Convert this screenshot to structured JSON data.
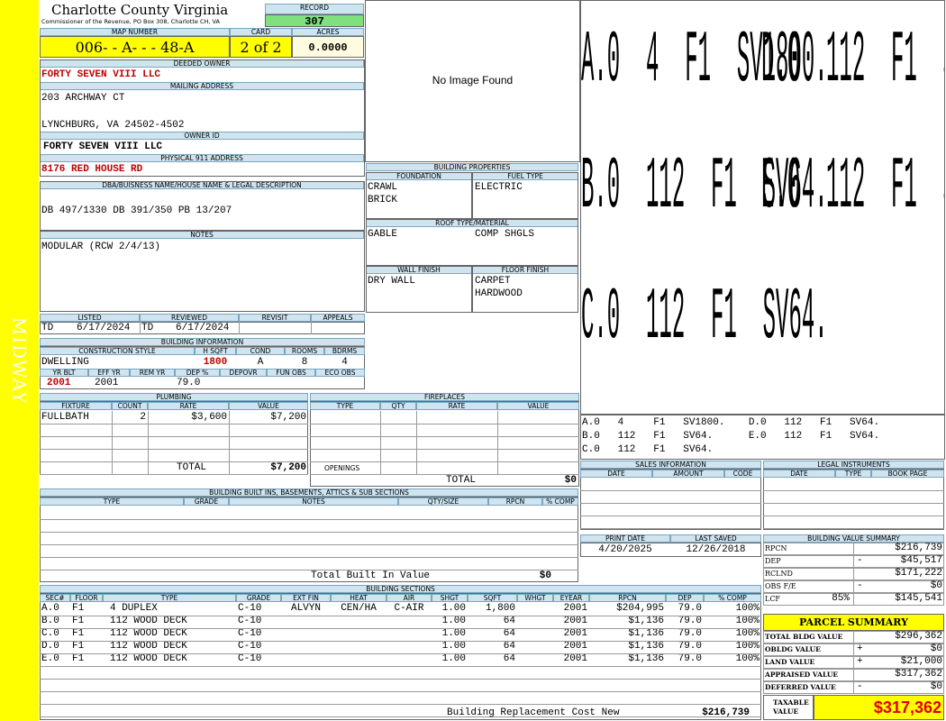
{
  "side_label": "MIDWAY",
  "header": {
    "county": "Charlotte County Virginia",
    "address": "Commissioner of the Revenue, PO Box 308, Charlotte CH, VA",
    "record_label": "RECORD",
    "record_value": "307",
    "map_number_label": "MAP NUMBER",
    "map_number": "006- - A- - - 48-A",
    "card_label": "CARD",
    "card_value": "2 of 2",
    "acres_label": "ACRES",
    "acres_value": "0.0000"
  },
  "owner": {
    "deeded_owner_label": "DEEDED OWNER",
    "deeded_owner": "FORTY SEVEN VIII LLC",
    "mailing_address_label": "MAILING ADDRESS",
    "mailing_line1": "203 ARCHWAY CT",
    "mailing_line2": "LYNCHBURG, VA 24502-4502",
    "owner_id_label": "OWNER ID",
    "owner_id": "FORTY SEVEN VIII LLC",
    "physical_address_label": "PHYSICAL 911 ADDRESS",
    "physical_address": "8176 RED HOUSE RD",
    "dba_label": "DBA/BUISNESS NAME/HOUSE NAME & LEGAL DESCRIPTION",
    "dba_value": "DB 497/1330 DB 391/350 PB 13/207",
    "notes_label": "NOTES",
    "notes_value": "MODULAR (RCW 2/4/13)"
  },
  "image": {
    "placeholder": "No Image Found"
  },
  "building_properties": {
    "title": "BUILDING PROPERTIES",
    "foundation_label": "FOUNDATION",
    "foundation_1": "CRAWL",
    "foundation_2": "BRICK",
    "fuel_label": "FUEL TYPE",
    "fuel_1": "ELECTRIC",
    "roof_label": "ROOF TYPE/MATERIAL",
    "roof_type": "GABLE",
    "roof_material": "COMP SHGLS",
    "wall_label": "WALL FINISH",
    "wall_1": "DRY WALL",
    "floor_label": "FLOOR FINISH",
    "floor_1": "CARPET",
    "floor_2": "HARDWOOD"
  },
  "review": {
    "listed_label": "LISTED",
    "listed_by": "TD",
    "listed_date": "6/17/2024",
    "reviewed_label": "REVIEWED",
    "reviewed_by": "TD",
    "reviewed_date": "6/17/2024",
    "revisit_label": "REVISIT",
    "appeals_label": "APPEALS"
  },
  "building_info": {
    "title": "BUILDING INFORMATION",
    "construction_style_label": "CONSTRUCTION STYLE",
    "construction_style": "DWELLING",
    "hsqft_label": "H SQFT",
    "hsqft": "1800",
    "cond_label": "COND",
    "cond": "A",
    "rooms_label": "ROOMS",
    "rooms": "8",
    "bdrms_label": "BDRMS",
    "bdrms": "4",
    "yr_blt_label": "YR BLT",
    "yr_blt": "2001",
    "eff_yr_label": "EFF YR",
    "eff_yr": "2001",
    "rem_yr_label": "REM YR",
    "dep_pct_label": "DEP %",
    "dep_pct": "79.0",
    "depovr_label": "DEPOVR",
    "fun_obs_label": "FUN OBS",
    "eco_obs_label": "ECO OBS"
  },
  "plumbing": {
    "title": "PLUMBING",
    "columns": [
      "FIXTURE",
      "COUNT",
      "RATE",
      "VALUE"
    ],
    "rows": [
      {
        "fixture": "FULLBATH",
        "count": "2",
        "rate": "$3,600",
        "value": "$7,200"
      }
    ],
    "total_label": "TOTAL",
    "total_value": "$7,200"
  },
  "fireplaces": {
    "title": "FIREPLACES",
    "columns": [
      "TYPE",
      "QTY",
      "RATE",
      "VALUE"
    ],
    "openings_label": "OPENINGS",
    "total_label": "TOTAL",
    "total_value": "$0"
  },
  "built_ins": {
    "title": "BUILDING BUILT INS, BASEMENTS, ATTICS & SUB SECTIONS",
    "columns": [
      "TYPE",
      "GRADE",
      "NOTES",
      "QTY/SIZE",
      "RPCN",
      "% COMP"
    ],
    "total_label": "Total Built In Value",
    "total_value": "$0"
  },
  "sketch": {
    "labels": [
      "A.0  4  F1  SV1800.",
      "D.0  112  F1  SV64.",
      "B.0  112  F1  SV64.",
      "E.0  112  F1  SV64.",
      "C.0  112  F1  SV64."
    ],
    "legend_line1": "A.0   4     F1   SV1800.    D.0   112   F1   SV64.",
    "legend_line2": "B.0   112   F1   SV64.      E.0   112   F1   SV64.",
    "legend_line3": "C.0   112   F1   SV64."
  },
  "sales": {
    "title": "SALES INFORMATION",
    "columns": [
      "DATE",
      "AMOUNT",
      "CODE"
    ]
  },
  "legal": {
    "title": "LEGAL INSTRUMENTS",
    "columns": [
      "DATE",
      "TYPE",
      "BOOK PAGE"
    ]
  },
  "dates": {
    "print_date_label": "PRINT DATE",
    "print_date": "4/20/2025",
    "last_saved_label": "LAST SAVED",
    "last_saved": "12/26/2018"
  },
  "value_summary": {
    "title": "BUILDING VALUE SUMMARY",
    "rows": [
      {
        "label": "RPCN",
        "sign": "",
        "value": "$216,739"
      },
      {
        "label": "DEP",
        "sign": "-",
        "value": "$45,517"
      },
      {
        "label": "RCLND",
        "sign": "",
        "value": "$171,222"
      },
      {
        "label": "OBS F/E",
        "sign": "-",
        "value": "$0"
      },
      {
        "label": "LCF",
        "pct": "85%",
        "sign": "",
        "value": "$145,541"
      }
    ]
  },
  "parcel_summary": {
    "title": "PARCEL SUMMARY",
    "rows": [
      {
        "label": "TOTAL BLDG VALUE",
        "sign": "",
        "value": "$296,362"
      },
      {
        "label": "OBLDG VALUE",
        "sign": "+",
        "value": "$0"
      },
      {
        "label": "LAND VALUE",
        "sign": "+",
        "value": "$21,000"
      },
      {
        "label": "APPRAISED VALUE",
        "sign": "",
        "value": "$317,362"
      },
      {
        "label": "DEFERRED VALUE",
        "sign": "-",
        "value": "$0"
      }
    ],
    "taxable_label_1": "TAXABLE",
    "taxable_label_2": "VALUE",
    "taxable_value": "$317,362"
  },
  "building_sections": {
    "title": "BUILDING SECTIONS",
    "columns": [
      "SEC#",
      "FLOOR",
      "TYPE",
      "GRADE",
      "EXT FIN",
      "HEAT",
      "AIR",
      "SHGT",
      "SQFT",
      "WHGT",
      "EYEAR",
      "RPCN",
      "DEP",
      "% COMP"
    ],
    "rows": [
      {
        "sec": "A.0",
        "floor": "F1",
        "type": "4 DUPLEX",
        "grade": "C-10",
        "ext": "ALVYN",
        "heat": "CEN/HA",
        "air": "C-AIR",
        "shgt": "1.00",
        "sqft": "1,800",
        "whgt": "",
        "eyear": "2001",
        "rpcn": "$204,995",
        "dep": "79.0",
        "comp": "100%"
      },
      {
        "sec": "B.0",
        "floor": "F1",
        "type": "112 WOOD DECK",
        "grade": "C-10",
        "ext": "",
        "heat": "",
        "air": "",
        "shgt": "1.00",
        "sqft": "64",
        "whgt": "",
        "eyear": "2001",
        "rpcn": "$1,136",
        "dep": "79.0",
        "comp": "100%"
      },
      {
        "sec": "C.0",
        "floor": "F1",
        "type": "112 WOOD DECK",
        "grade": "C-10",
        "ext": "",
        "heat": "",
        "air": "",
        "shgt": "1.00",
        "sqft": "64",
        "whgt": "",
        "eyear": "2001",
        "rpcn": "$1,136",
        "dep": "79.0",
        "comp": "100%"
      },
      {
        "sec": "D.0",
        "floor": "F1",
        "type": "112 WOOD DECK",
        "grade": "C-10",
        "ext": "",
        "heat": "",
        "air": "",
        "shgt": "1.00",
        "sqft": "64",
        "whgt": "",
        "eyear": "2001",
        "rpcn": "$1,136",
        "dep": "79.0",
        "comp": "100%"
      },
      {
        "sec": "E.0",
        "floor": "F1",
        "type": "112 WOOD DECK",
        "grade": "C-10",
        "ext": "",
        "heat": "",
        "air": "",
        "shgt": "1.00",
        "sqft": "64",
        "whgt": "",
        "eyear": "2001",
        "rpcn": "$1,136",
        "dep": "79.0",
        "comp": "100%"
      }
    ],
    "replacement_label": "Building Replacement Cost New",
    "replacement_value": "$216,739"
  },
  "colors": {
    "sidebar": "#ffff00",
    "label_blue": "#cfe4ef",
    "record_green": "#7ee07e",
    "red_text": "#c00000"
  }
}
